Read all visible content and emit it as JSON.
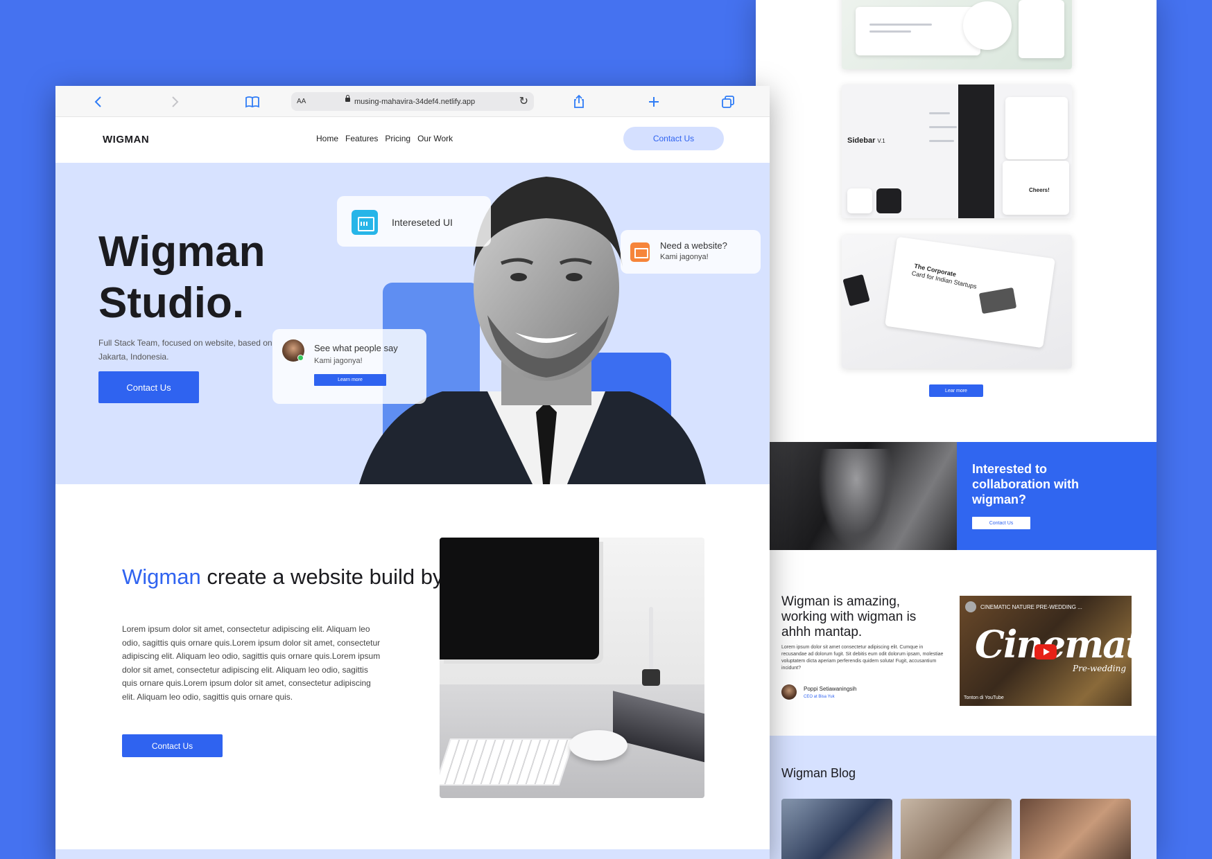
{
  "colors": {
    "background": "#4572f0",
    "accent": "#2f63f0",
    "hero_background": "#d7e2ff"
  },
  "browser": {
    "text_size_label": "AA",
    "url": "musing-mahavira-34def4.netlify.app",
    "icons": [
      "chevron-left-icon",
      "chevron-right-icon",
      "book-icon",
      "lock-icon",
      "reload-icon",
      "share-icon",
      "plus-icon",
      "tabs-icon"
    ]
  },
  "site": {
    "logo": "WIGMAN",
    "nav": [
      "Home",
      "Features",
      "Pricing",
      "Our Work"
    ],
    "nav_contact": "Contact Us"
  },
  "hero": {
    "title_line1": "Wigman",
    "title_line2": "Studio.",
    "subtitle": "Full Stack Team, focused on website, based on Jakarta, Indonesia.",
    "button": "Contact Us",
    "card_interest": "Intereseted UI",
    "card_website_title": "Need a website?",
    "card_website_sub": "Kami jagonya!",
    "card_people_title": "See what people say",
    "card_people_sub": "Kami jagonya!",
    "card_people_button": "Learn more"
  },
  "about": {
    "title_accent": "Wigman",
    "title_rest": " create a website build by craft.",
    "body": "Lorem ipsum dolor sit amet, consectetur adipiscing elit. Aliquam leo odio, sagittis quis ornare quis.Lorem ipsum dolor sit amet, consectetur adipiscing elit. Aliquam leo odio, sagittis quis ornare quis.Lorem ipsum dolor sit amet, consectetur adipiscing elit. Aliquam leo odio, sagittis quis ornare quis.Lorem ipsum dolor sit amet, consectetur adipiscing elit. Aliquam leo odio, sagittis quis ornare quis.",
    "button": "Contact Us"
  },
  "right": {
    "shot2_title": "Sidebar",
    "shot2_version": "V.1",
    "shot2_cheers": "Cheers!",
    "shot3_title": "The Corporate",
    "shot3_subtitle": "Card for Indian Startups",
    "learn_more": "Lear more",
    "collab_title": "Interested to collaboration with wigman?",
    "collab_button": "Contact Us",
    "testimonial_title": "Wigman is amazing, working with wigman is ahhh mantap.",
    "testimonial_body": "Lorem ipsum dolor sit amet consectetur adipiscing elit. Cumque in recusandae ad dolorum fugit. Sit debitis eum odit dolorum ipsam, molestiae voluptatem dicta aperiam perferendis quidem soluta! Fugit, accusantium incidunt?",
    "testimonial_name": "Poppi Setiawaningsih",
    "testimonial_role": "CEO at Bisa Yuk",
    "video_title": "CINEMATIC NATURE PRE-WEDDING ...",
    "video_script": "Cinematic",
    "video_sub": "Pre-wedding",
    "video_footer": "Tonton di YouTube",
    "blog_title": "Wigman Blog"
  }
}
